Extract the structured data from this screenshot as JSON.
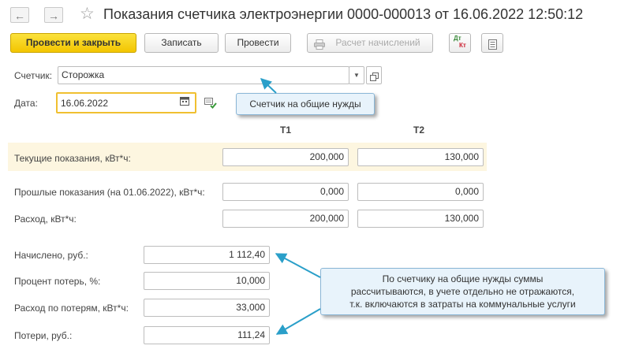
{
  "header": {
    "back_glyph": "←",
    "forward_glyph": "→",
    "star_glyph": "☆",
    "title": "Показания счетчика электроэнергии 0000-000013 от 16.06.2022 12:50:12"
  },
  "toolbar": {
    "post_close_label": "Провести и закрыть",
    "save_label": "Записать",
    "post_label": "Провести",
    "calc_label": "Расчет начислений",
    "dtkt_top": "Дт",
    "dtkt_bottom": "Кт"
  },
  "form": {
    "meter_label": "Счетчик:",
    "meter_value": "Сторожка",
    "date_label": "Дата:",
    "date_value": "16.06.2022",
    "col_t1": "Т1",
    "col_t2": "Т2",
    "current_label": "Текущие показания, кВт*ч:",
    "current_t1": "200,000",
    "current_t2": "130,000",
    "previous_label": "Прошлые показания (на 01.06.2022), кВт*ч:",
    "previous_t1": "0,000",
    "previous_t2": "0,000",
    "consumption_label": "Расход, кВт*ч:",
    "consumption_t1": "200,000",
    "consumption_t2": "130,000",
    "accrued_label": "Начислено, руб.:",
    "accrued_value": "1 112,40",
    "loss_percent_label": "Процент потерь, %:",
    "loss_percent_value": "10,000",
    "loss_consumption_label": "Расход по потерям, кВт*ч:",
    "loss_consumption_value": "33,000",
    "losses_label": "Потери, руб.:",
    "losses_value": "111,24"
  },
  "callouts": {
    "meter_note": "Счетчик на общие нужды",
    "sum_note_line1": "По счетчику на общие нужды суммы",
    "sum_note_line2": "рассчитываются, в учете отдельно не отражаются,",
    "sum_note_line3": "т.к. включаются в затраты на коммунальные услуги"
  },
  "colors": {
    "primary_button": "#f3c500",
    "highlight_band": "#fdf6e0",
    "callout_fill": "#e8f3fb",
    "arrow": "#2a9fc9"
  }
}
